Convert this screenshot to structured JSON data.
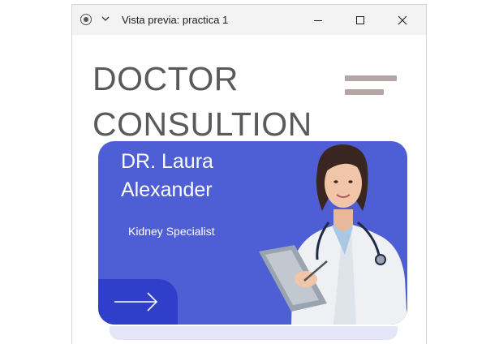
{
  "window": {
    "title": "Vista previa: practica 1",
    "minimize_icon": "minimize-icon",
    "maximize_icon": "maximize-icon",
    "close_icon": "close-icon"
  },
  "page": {
    "heading_line1": "DOCTOR",
    "heading_line2": "CONSULTION",
    "menu_icon": "hamburger-menu-icon"
  },
  "card": {
    "name_line1": "DR. Laura",
    "name_line2": "Alexander",
    "specialty": "Kidney Specialist",
    "arrow_icon": "arrow-right-icon",
    "image": "doctor-photo"
  },
  "colors": {
    "card_bg": "#4e5fd6",
    "arrow_button_bg": "#2f3fc9",
    "heading_text": "#5a5a5a",
    "hamburger": "#b5a6a6",
    "strip": "#e4e6f7"
  }
}
